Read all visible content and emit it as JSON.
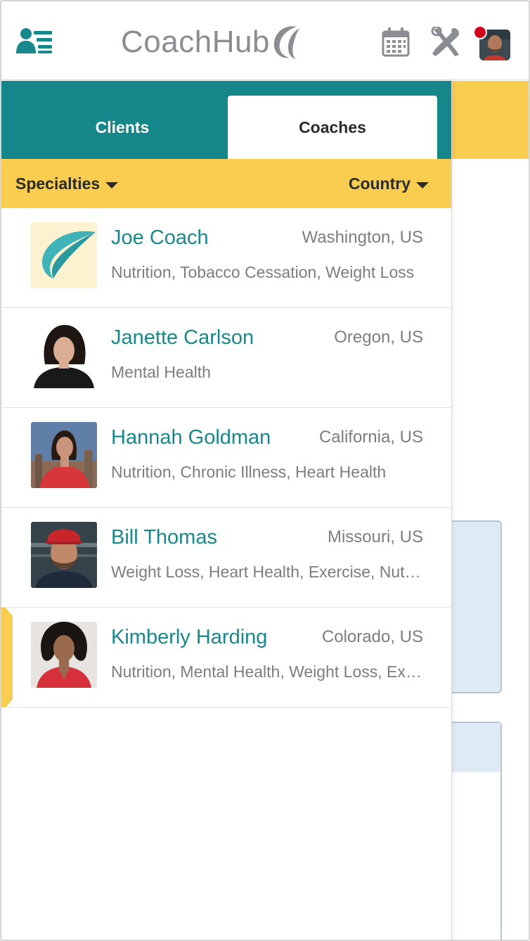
{
  "app": {
    "logo_text": "CoachHub",
    "brand_color": "#15868a",
    "accent_color": "#f9cd4f",
    "notification_color": "#d0021b"
  },
  "header": {
    "icons": [
      "menu-people-list-icon",
      "calendar-icon",
      "tools-icon",
      "profile-avatar"
    ]
  },
  "tabs": [
    {
      "label": "Clients",
      "active": false
    },
    {
      "label": "Coaches",
      "active": true
    }
  ],
  "filters": {
    "specialties_label": "Specialties",
    "country_label": "Country"
  },
  "coaches": [
    {
      "name": "Joe Coach",
      "location": "Washington, US",
      "specialties": "Nutrition, Tobacco Cessation, Weight Loss",
      "selected": false
    },
    {
      "name": "Janette Carlson",
      "location": "Oregon, US",
      "specialties": "Mental Health",
      "selected": false
    },
    {
      "name": "Hannah Goldman",
      "location": "California, US",
      "specialties": "Nutrition, Chronic Illness, Heart Health",
      "selected": false
    },
    {
      "name": "Bill Thomas",
      "location": "Missouri, US",
      "specialties": "Weight Loss, Heart Health, Exercise, Nutrition",
      "selected": false
    },
    {
      "name": "Kimberly Harding",
      "location": "Colorado, US",
      "specialties": "Nutrition, Mental Health, Weight Loss, Exercise",
      "selected": true
    }
  ]
}
